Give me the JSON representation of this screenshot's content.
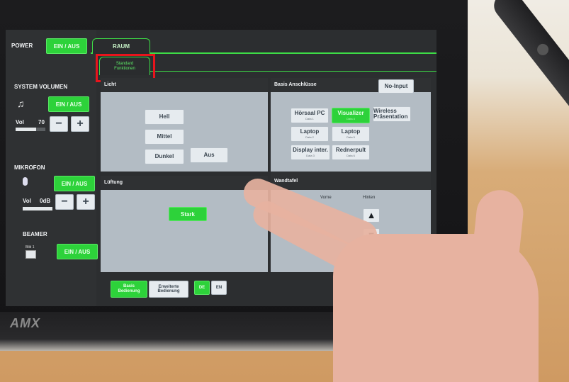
{
  "brand": "AMX",
  "sidebar": {
    "power": {
      "label": "POWER",
      "button": "EIN / AUS"
    },
    "system_volume": {
      "label": "SYSTEM VOLUMEN",
      "button": "EIN / AUS",
      "vol_label": "Vol",
      "vol_value": "70",
      "vol_level": 0.7,
      "minus": "−",
      "plus": "+"
    },
    "mikrofon": {
      "label": "MIKROFON",
      "button": "EIN / AUS",
      "vol_label": "Vol",
      "vol_value": "0dB",
      "minus": "−",
      "plus": "+"
    },
    "beamer": {
      "label": "BEAMER",
      "source": "Bild 1",
      "button": "EIN / AUS"
    }
  },
  "tabs": {
    "raum": "RAUM",
    "standard_line1": "Standard",
    "standard_line2": "Funktionen"
  },
  "licht": {
    "title": "Licht",
    "buttons": [
      "Hell",
      "Mittel",
      "Dunkel",
      "Aus"
    ]
  },
  "basis": {
    "title": "Basis Anschlüsse",
    "no_input": "No-Input",
    "inputs": [
      {
        "label": "Hörsaal PC",
        "sub": "Data 1"
      },
      {
        "label": "Visualizer",
        "sub": "Data 4",
        "active": true
      },
      {
        "label": "Wireless Präsentation",
        "sub": ""
      },
      {
        "label": "Laptop",
        "sub": "Data 2"
      },
      {
        "label": "Laptop",
        "sub": "Data 5"
      },
      {
        "label": "Display inter.",
        "sub": "Data 3"
      },
      {
        "label": "Rednerpult",
        "sub": "Data 6"
      }
    ]
  },
  "lueftung": {
    "title": "Lüftung",
    "button": "Stark"
  },
  "wandtafel": {
    "title": "Wandtafel",
    "vorne": "Vorne",
    "hinten": "Hinten",
    "up": "▲",
    "down": "▼"
  },
  "bottom": {
    "basis_1": "Basis",
    "basis_2": "Bedienung",
    "erweitert_1": "Erweiterte",
    "erweitert_2": "Bedienung",
    "de": "DE",
    "en": "EN"
  }
}
